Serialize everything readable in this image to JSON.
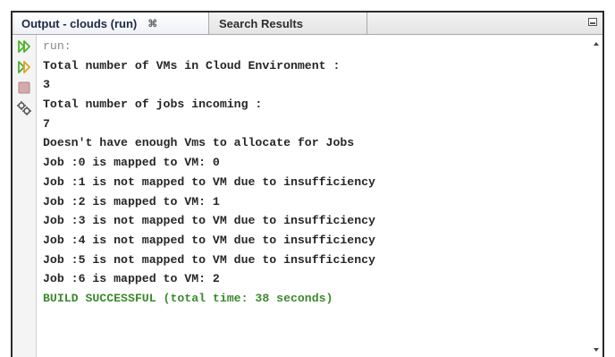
{
  "tabs": [
    {
      "label": "Output - clouds (run)",
      "close": "⌘"
    },
    {
      "label": "Search Results"
    }
  ],
  "toolbar": {
    "icons": [
      "rerun-icon",
      "rerun-with-options-icon",
      "stop-icon",
      "settings-icon"
    ],
    "colors": {
      "run": "#4caf2a",
      "stop": "#c9a0a0"
    }
  },
  "output": {
    "lines": [
      "run:",
      "Total number of VMs in Cloud Environment :",
      "3",
      "Total number of jobs incoming :",
      "7",
      "Doesn't have enough Vms to allocate for Jobs",
      "Job :0 is mapped to VM: 0",
      "Job :1 is not mapped to VM due to insufficiency",
      "Job :2 is mapped to VM: 1",
      "Job :3 is not mapped to VM due to insufficiency",
      "Job :4 is not mapped to VM due to insufficiency",
      "Job :5 is not mapped to VM due to insufficiency",
      "Job :6 is mapped to VM: 2",
      "BUILD SUCCESSFUL (total time: 38 seconds)"
    ],
    "success_color": "#3c8a2e"
  }
}
